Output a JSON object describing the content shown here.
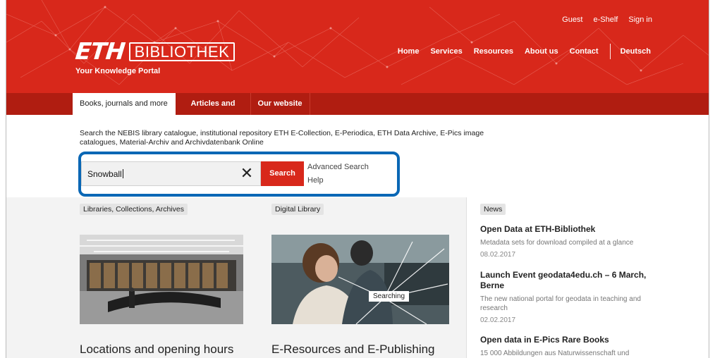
{
  "header": {
    "logo_eth": "ETH",
    "logo_bib": "BIBLIOTHEK",
    "tagline": "Your Knowledge Portal",
    "top_links": [
      "Guest",
      "e-Shelf",
      "Sign in"
    ],
    "nav": [
      "Home",
      "Services",
      "Resources",
      "About us",
      "Contact"
    ],
    "language": "Deutsch"
  },
  "tabs": [
    {
      "label": "Books, journals and more",
      "active": true
    },
    {
      "label": "Articles and more",
      "active": false
    },
    {
      "label": "Our website",
      "active": false
    }
  ],
  "search": {
    "description": "Search the NEBIS library catalogue, institutional repository ETH E-Collection, E-Periodica, ETH Data Archive, E-Pics image catalogues, Material-Archiv and Archivdatenbank Online",
    "value": "Snowball",
    "clear_glyph": "✕",
    "button": "Search",
    "advanced": "Advanced Search",
    "help": "Help"
  },
  "sections": {
    "libraries_label": "Libraries, Collections, Archives",
    "digital_label": "Digital Library",
    "news_label": "News",
    "searching_badge": "Searching",
    "locations_title": "Locations and opening hours",
    "eresources_title": "E-Resources and E-Publishing"
  },
  "news": [
    {
      "title": "Open Data at ETH-Bibliothek",
      "desc": "Metadata sets for download compiled at a glance",
      "date": "08.02.2017"
    },
    {
      "title": "Launch Event geodata4edu.ch – 6 March, Berne",
      "desc": "The new national portal for geodata in teaching and research",
      "date": "02.02.2017"
    },
    {
      "title": "Open data in E-Pics Rare Books",
      "desc": "15 000 Abbildungen aus Naturwissenschaft und",
      "date": ""
    }
  ],
  "colors": {
    "brand_red": "#d8281b",
    "dark_red": "#b01d11",
    "highlight_blue": "#0a67b5"
  }
}
